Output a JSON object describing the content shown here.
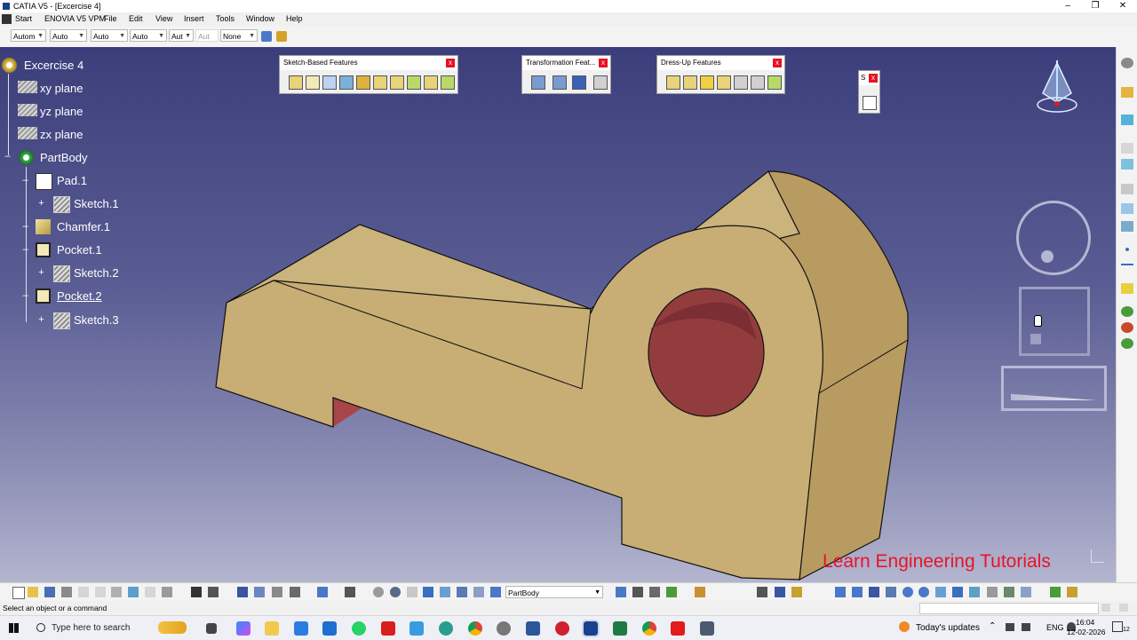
{
  "window": {
    "title": "CATIA V5 - [Excercise 4]",
    "controls": [
      "minimize-icon",
      "restore-icon",
      "close-icon"
    ]
  },
  "menubar": {
    "items": [
      "Start",
      "ENOVIA V5 VPM",
      "File",
      "Edit",
      "View",
      "Insert",
      "Tools",
      "Window",
      "Help"
    ]
  },
  "toolbar": {
    "combos": [
      "Autom",
      "Auto",
      "Auto",
      "Auto",
      "Aut",
      "Aut",
      "None"
    ]
  },
  "tree": {
    "root": "Excercise 4",
    "planes": [
      "xy plane",
      "yz plane",
      "zx plane"
    ],
    "body": "PartBody",
    "features": [
      {
        "label": "Pad.1",
        "child": "Sketch.1"
      },
      {
        "label": "Chamfer.1",
        "child": null
      },
      {
        "label": "Pocket.1",
        "child": "Sketch.2"
      },
      {
        "label": "Pocket.2",
        "child": "Sketch.3"
      }
    ]
  },
  "floating_toolbars": [
    {
      "title": "Sketch-Based Features"
    },
    {
      "title": "Transformation Feat..."
    },
    {
      "title": "Dress-Up Features"
    },
    {
      "title": "S"
    }
  ],
  "watermark": "Learn Engineering Tutorials",
  "bottom": {
    "current_body": "PartBody"
  },
  "status": {
    "prompt": "Select an object or a command"
  },
  "taskbar": {
    "search_placeholder": "Type here to search",
    "weather": "Today's updates",
    "lang": "ENG",
    "time": "16:04",
    "date": "12-02-2026",
    "notifications": "12"
  },
  "colors": {
    "part": "#c9b07a",
    "hole": "#8a2f35",
    "viewport_top": "#3c3e7b",
    "viewport_bottom": "#b4b5cf",
    "watermark": "#e8142a"
  }
}
